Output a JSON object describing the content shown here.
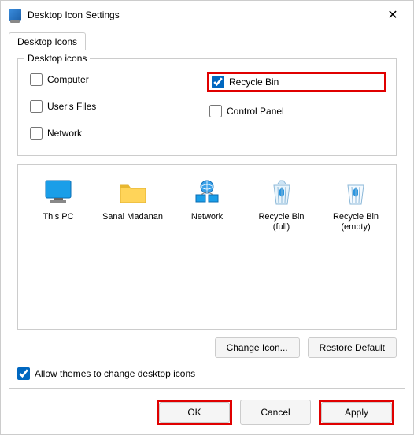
{
  "titlebar": {
    "title": "Desktop Icon Settings"
  },
  "tab": {
    "label": "Desktop Icons"
  },
  "fieldset": {
    "legend": "Desktop icons"
  },
  "checkboxes": {
    "computer": {
      "label": "Computer",
      "checked": false
    },
    "recycle_bin": {
      "label": "Recycle Bin",
      "checked": true,
      "highlight": true
    },
    "users_files": {
      "label": "User's Files",
      "checked": false
    },
    "control_panel": {
      "label": "Control Panel",
      "checked": false
    },
    "network": {
      "label": "Network",
      "checked": false
    }
  },
  "icons": {
    "this_pc": {
      "label": "This PC"
    },
    "user_folder": {
      "label": "Sanal Madanan"
    },
    "network": {
      "label": "Network"
    },
    "bin_full": {
      "label": "Recycle Bin (full)"
    },
    "bin_empty": {
      "label": "Recycle Bin (empty)"
    }
  },
  "buttons": {
    "change_icon": "Change Icon...",
    "restore_default": "Restore Default"
  },
  "allow_themes": {
    "label": "Allow themes to change desktop icons",
    "checked": true
  },
  "footer": {
    "ok": {
      "label": "OK",
      "highlight": true
    },
    "cancel": {
      "label": "Cancel",
      "highlight": false
    },
    "apply": {
      "label": "Apply",
      "highlight": true
    }
  }
}
